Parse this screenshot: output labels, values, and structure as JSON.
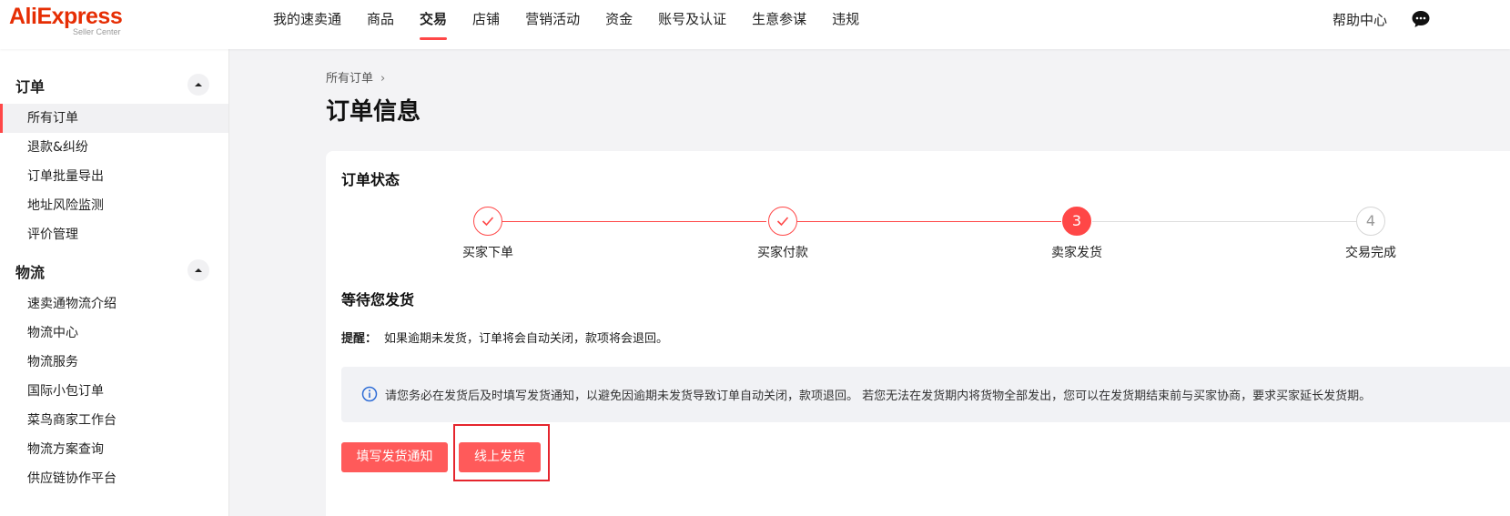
{
  "header": {
    "logo_main": "AliExpress",
    "logo_sub": "Seller Center",
    "nav": [
      "我的速卖通",
      "商品",
      "交易",
      "店铺",
      "营销活动",
      "资金",
      "账号及认证",
      "生意参谋",
      "违规"
    ],
    "active_nav": "交易",
    "help": "帮助中心"
  },
  "sidebar": {
    "sections": [
      {
        "title": "订单",
        "items": [
          "所有订单",
          "退款&纠纷",
          "订单批量导出",
          "地址风险监测",
          "评价管理"
        ]
      },
      {
        "title": "物流",
        "items": [
          "速卖通物流介绍",
          "物流中心",
          "物流服务",
          "国际小包订单",
          "菜鸟商家工作台",
          "物流方案查询",
          "供应链协作平台"
        ]
      }
    ],
    "active_item": "所有订单"
  },
  "main": {
    "breadcrumb": "所有订单",
    "breadcrumb_sep": "›",
    "title": "订单信息",
    "order_status": {
      "title": "订单状态",
      "steps": [
        {
          "label": "买家下单",
          "status": "done"
        },
        {
          "label": "买家付款",
          "status": "done"
        },
        {
          "label": "卖家发货",
          "status": "current",
          "number": "3"
        },
        {
          "label": "交易完成",
          "status": "pending",
          "number": "4"
        }
      ]
    },
    "wait_title": "等待您发货",
    "reminder_label": "提醒：",
    "reminder_text": "如果逾期未发货，订单将会自动关闭，款项将会退回。",
    "info_text": "请您务必在发货后及时填写发货通知，以避免因逾期未发货导致订单自动关闭，款项退回。 若您无法在发货期内将货物全部发出，您可以在发货期结束前与买家协商，要求买家延长发货期。",
    "buttons": {
      "notify": "填写发货通知",
      "online": "线上发货"
    }
  },
  "colors": {
    "accent": "#ff4747",
    "button": "#ff5a5a",
    "highlight": "#e5252d",
    "logo": "#e62e04"
  }
}
